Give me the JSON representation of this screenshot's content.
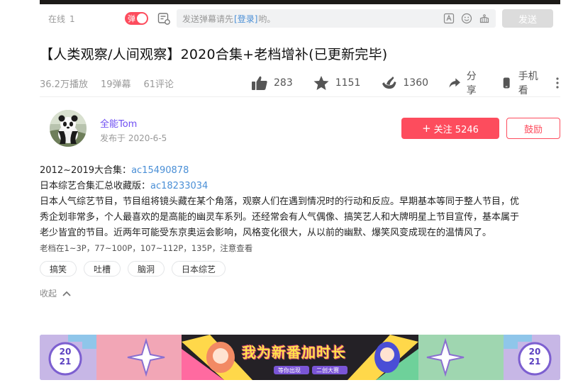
{
  "danmaku": {
    "online_label": "在线",
    "online_count": "1",
    "toggle_label": "弹",
    "placeholder_before": "发送弹幕请先",
    "login_link": "[登录]",
    "placeholder_after": "哟。",
    "send_label": "发送"
  },
  "video": {
    "title": "【人类观察/人间观察】2020合集+老档增补(已更新完毕)",
    "plays": "36.2万播放",
    "danmaku_count": "19弹幕",
    "comments": "61评论"
  },
  "actions": {
    "like": "283",
    "favorite": "1151",
    "banana": "1360",
    "share": "分享",
    "mobile": "手机看"
  },
  "uploader": {
    "name": "全能Tom",
    "publish_time": "发布于 2020-6-5",
    "follow_label": "关注 5246",
    "reward_label": "鼓励"
  },
  "description": {
    "line1_prefix": "2012~2019大合集：",
    "line1_link": "ac15490878",
    "line2_prefix": "日本综艺合集汇总收藏版：",
    "line2_link": "ac18233034",
    "line3": "日本人气综艺节目，节目组将镜头藏在某个角落，观察人们在遇到情况时的行动和反应。早期基本等同于整人节目，优",
    "line4": "秀企划非常多，个人最喜欢的是高能的幽灵车系列。还经常会有人气偶像、搞笑艺人和大牌明星上节目宣传，基本属于",
    "line5": "老少皆宜的节目。近两年可能受东京奥运会影响，风格变化很大，从以前的幽默、爆笑风变成现在的温情风了。",
    "note": "老档在1~3P，77~100P，107~112P，135P，注意查看"
  },
  "tags": [
    "搞笑",
    "吐槽",
    "脑洞",
    "日本综艺"
  ],
  "collapse_label": "收起",
  "banner": {
    "headline": "我为新番加时长",
    "sub_left": "等你出现",
    "sub_right": "二创大赛",
    "year_top": "20",
    "year_bottom": "21"
  },
  "colors": {
    "accent": "#fd4c5d",
    "link": "#4a8fd6",
    "uploader_name": "#6f4ff2",
    "muted": "#999999"
  }
}
